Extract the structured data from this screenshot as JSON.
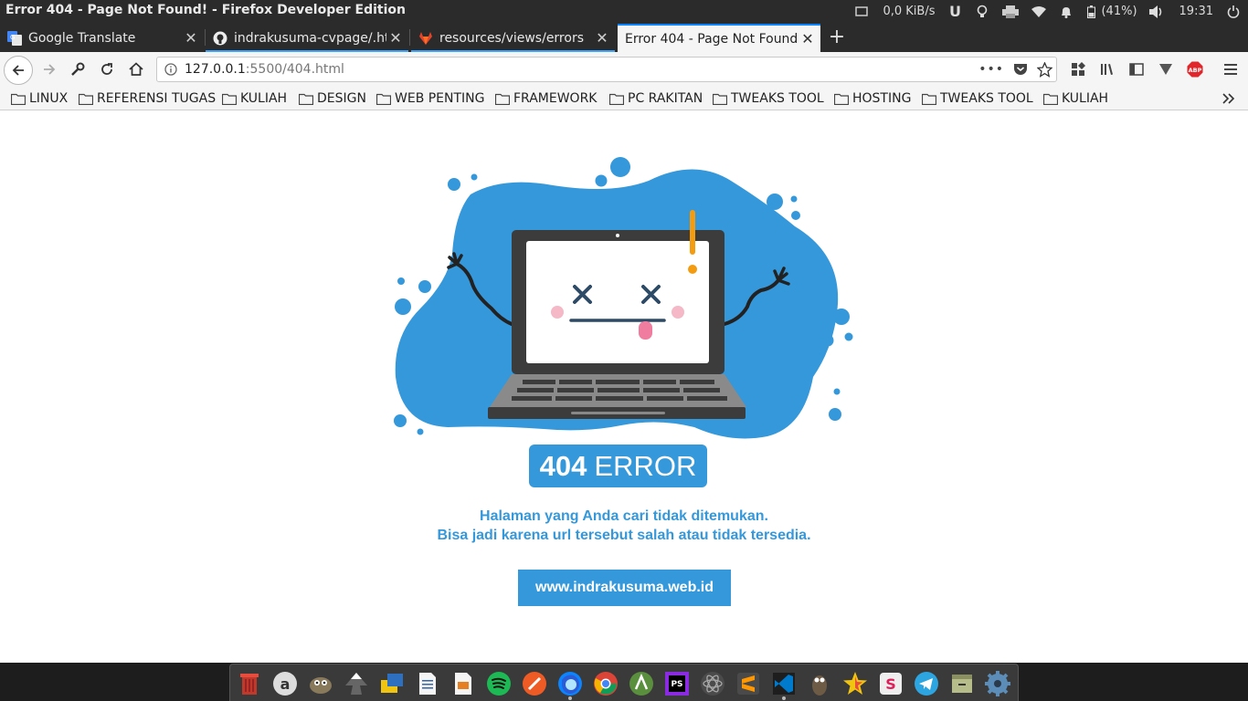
{
  "window": {
    "title": "Error 404 - Page Not Found! - Firefox Developer Edition"
  },
  "tray": {
    "net_speed": "0,0 KiB/s",
    "battery": "(41%)",
    "clock": "19:31"
  },
  "tabs": [
    {
      "label": "Google Translate",
      "icon": "google-translate-icon"
    },
    {
      "label": "indrakusuma-cvpage/.htaccess",
      "icon": "github-icon"
    },
    {
      "label": "resources/views/errors",
      "icon": "gitlab-icon"
    },
    {
      "label": "Error 404 - Page Not Found!",
      "icon": "none",
      "active": true
    }
  ],
  "url": {
    "host": "127.0.0.1",
    "rest": ":5500/404.html"
  },
  "bookmarks": [
    "LINUX",
    "REFERENSI TUGAS",
    "KULIAH",
    "DESIGN",
    "WEB PENTING",
    "FRAMEWORK",
    "PC RAKITAN",
    "TWEAKS TOOL",
    "HOSTING",
    "TWEAKS TOOL",
    "KULIAH"
  ],
  "page": {
    "badge_number": "404",
    "badge_word": "ERROR",
    "message_line1": "Halaman yang Anda cari tidak ditemukan.",
    "message_line2": "Bisa jadi karena url tersebut salah atau tidak tersedia.",
    "button_label": "www.indrakusuma.web.id"
  },
  "colors": {
    "accent": "#3498db",
    "tab_highlight": "#0a84ff",
    "warning": "#f39c12",
    "chrome_dark": "#2b2b2b"
  },
  "dock_icons": [
    "trash-icon",
    "amazon-icon",
    "gimp-icon",
    "inkscape-icon",
    "virtualbox-icon",
    "text-editor-icon",
    "document-viewer-icon",
    "spotify-icon",
    "postman-icon",
    "firefox-icon",
    "chrome-icon",
    "android-studio-icon",
    "phpstorm-icon",
    "atom-icon",
    "sublime-text-icon",
    "vscode-icon",
    "gimp-wilber-icon",
    "starred-icon",
    "slack-icon",
    "telegram-icon",
    "archive-manager-icon",
    "settings-icon"
  ]
}
